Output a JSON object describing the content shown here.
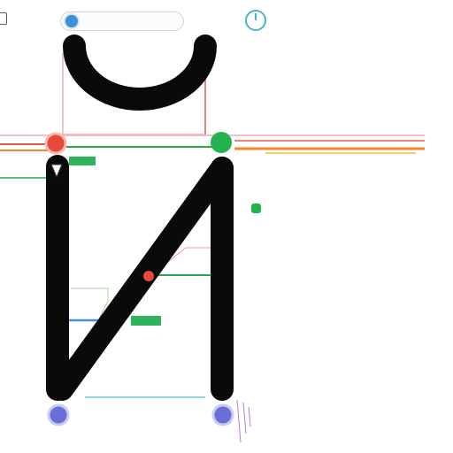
{
  "toolbar": {
    "left_icon": "square-outline-icon",
    "settings_icon": "gear-icon",
    "status_icon": "power-ring-icon"
  },
  "diagram": {
    "glyph_stroke_color": "#0a0a0a",
    "nodes": [
      {
        "id": "node-top-left",
        "color": "#e8483a"
      },
      {
        "id": "node-top-right",
        "color": "#23b24b"
      },
      {
        "id": "node-bottom-left",
        "color": "#6a6fd8"
      },
      {
        "id": "node-bottom-right",
        "color": "#6a6fd8"
      },
      {
        "id": "node-mid",
        "color": "#e8483a"
      }
    ],
    "guide_colors": {
      "red": "#e05a4a",
      "green": "#2aa84a",
      "orange": "#f08a2a",
      "blue": "#4a90d9",
      "cyan": "#6fc8d8",
      "pink": "#e896a8"
    }
  }
}
